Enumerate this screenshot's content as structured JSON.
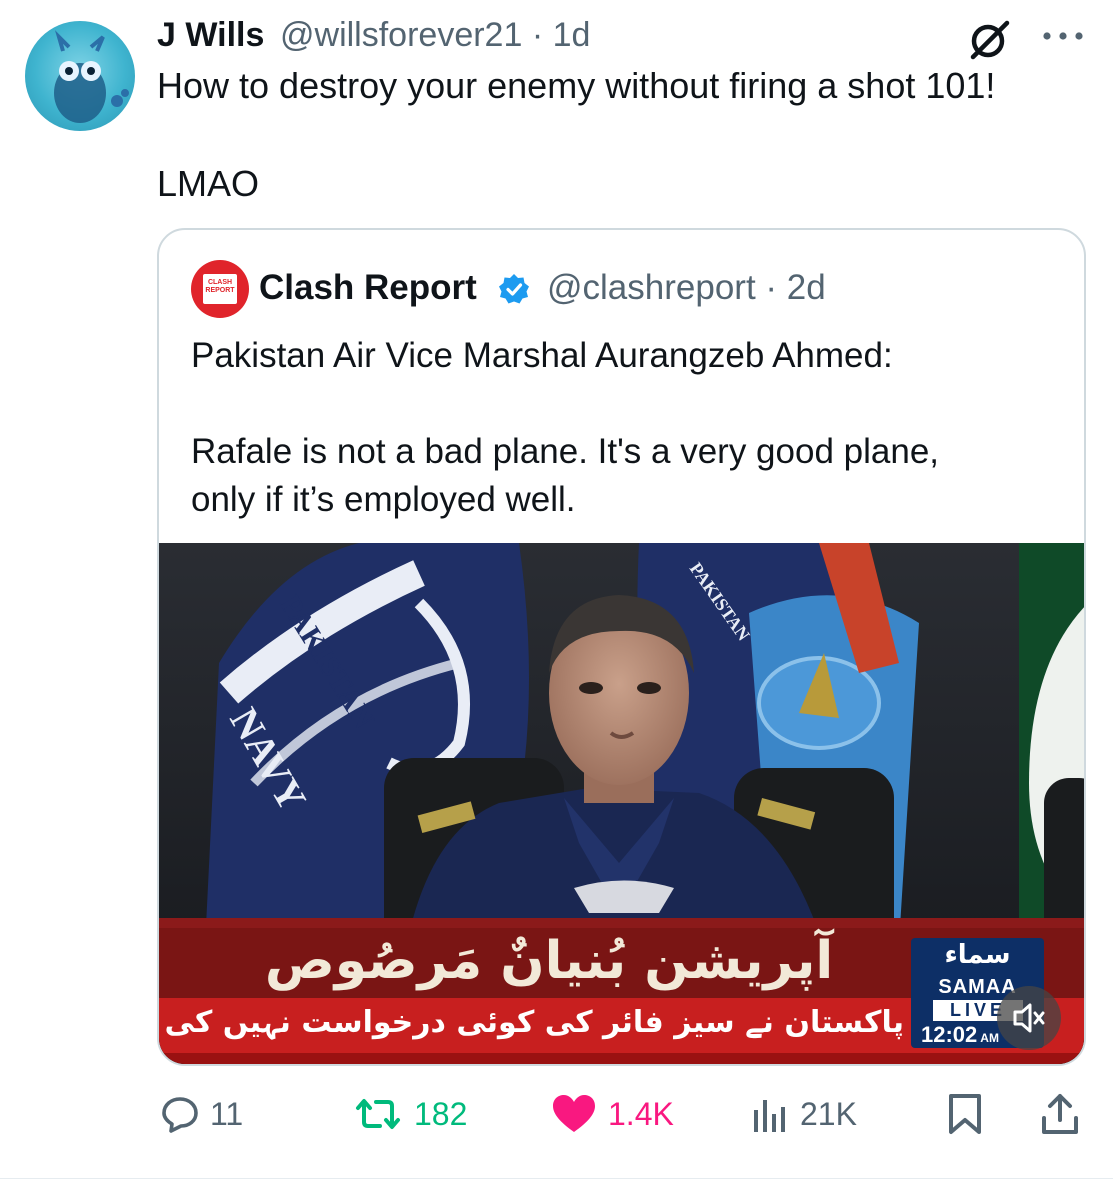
{
  "post": {
    "author_name": "J Wills",
    "author_handle": "@willsforever21",
    "time": "1d",
    "text_line1": "How to destroy your enemy without firing a shot 101!",
    "text_line2": "LMAO"
  },
  "quoted": {
    "logo_text": "CLASH REPORT",
    "author_name": "Clash Report",
    "author_handle": "@clashreport",
    "time": "2d",
    "text_line1": "Pakistan Air Vice Marshal Aurangzeb Ahmed:",
    "text_line2": "Rafale is not a bad plane. It's a very good plane,\nonly if it’s employed well.",
    "media": {
      "flag_left_text": "PAKISTAN",
      "flag_left_text2": "NAVY",
      "flag_right_text": "PAKISTAN",
      "ticker_headline": "آپریشن بُنیانٌ مَرصُوص",
      "ticker_sub": "پاکستان نے سیز فائر کی کوئی درخواست نہیں کی تھی، ڈی جی آئی ایس پی آر",
      "channel_urdu": "سماء",
      "channel_name": "SAMAA",
      "live_label": "LIVE",
      "clock": "12:02",
      "clock_ampm": "AM"
    }
  },
  "actions": {
    "replies": "11",
    "reposts": "182",
    "likes": "1.4K",
    "views": "21K"
  },
  "colors": {
    "muted": "#536471",
    "repost": "#00ba7c",
    "like": "#f91880",
    "verified": "#1d9bf0",
    "brand_red": "#e0242b"
  }
}
